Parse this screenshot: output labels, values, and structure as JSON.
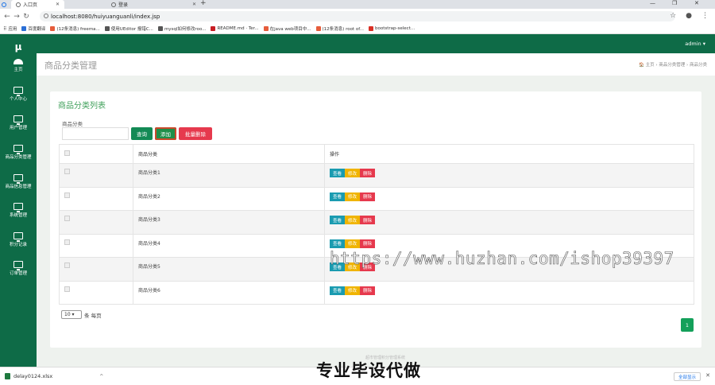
{
  "browser": {
    "tabs": [
      {
        "label": "入口页",
        "active": true
      },
      {
        "label": "登录",
        "active": false
      }
    ],
    "new_tab": "+",
    "url": "localhost:8080/huiyuanguanli/index.jsp",
    "bookmarks": [
      {
        "label": "应用",
        "color": "#4285f4"
      },
      {
        "label": "百度翻译",
        "color": "#2b6fd6"
      },
      {
        "label": "(12条消息) freema...",
        "color": "#e65c3b"
      },
      {
        "label": "使用UEditor 报错C...",
        "color": "#555555"
      },
      {
        "label": "mysql如何修改roo...",
        "color": "#555555"
      },
      {
        "label": "README.md · Ter...",
        "color": "#c71d23"
      },
      {
        "label": "在java web项目中...",
        "color": "#e65c3b"
      },
      {
        "label": "(12条消息) root of...",
        "color": "#e65c3b"
      },
      {
        "label": "bootstrap-select...",
        "color": "#d93025"
      }
    ]
  },
  "app": {
    "logo": "μ",
    "admin": "admin ▾",
    "sidebar": [
      {
        "label": "主页",
        "icon": "dashboard-icon"
      },
      {
        "label": "个人中心",
        "icon": "monitor-icon"
      },
      {
        "label": "用户管理",
        "icon": "monitor-icon"
      },
      {
        "label": "商品分类管理",
        "icon": "monitor-icon"
      },
      {
        "label": "商品信息管理",
        "icon": "monitor-icon"
      },
      {
        "label": "系统管理",
        "icon": "monitor-icon"
      },
      {
        "label": "积分记录",
        "icon": "monitor-icon"
      },
      {
        "label": "订单管理",
        "icon": "monitor-icon"
      }
    ],
    "page_title": "商品分类管理",
    "breadcrumb": "🏠 主页  ›  商品分类管理  ›  商品分类",
    "card_title": "商品分类列表",
    "filter": {
      "label": "商品分类",
      "value": ""
    },
    "buttons": {
      "query": "查询",
      "add": "添加",
      "batch_delete": "批量删除"
    },
    "table": {
      "headers": [
        "",
        "商品分类",
        "操作"
      ],
      "rows": [
        "商品分类1",
        "商品分类2",
        "商品分类3",
        "商品分类4",
        "商品分类5",
        "商品分类6"
      ],
      "actions": {
        "view": "查看",
        "edit": "修改",
        "delete": "删除"
      }
    },
    "pager": {
      "page_size": "10 ▾",
      "per_page_text": "条 每页",
      "current_page": "1"
    },
    "footer": "超市管理积分管理系统"
  },
  "overlay": {
    "watermark": "https://www.huzhan.com/ishop39397",
    "banner": "专业毕设代做"
  },
  "downloads": {
    "file": "delay0124.xlsx",
    "chevron": "^",
    "show_all": "全部显示",
    "close": "✕"
  },
  "colors": {
    "primary": "#0e6b47",
    "info": "#1a9bb0",
    "warning": "#f0b400",
    "danger": "#e6394d",
    "success": "#14a05a"
  }
}
